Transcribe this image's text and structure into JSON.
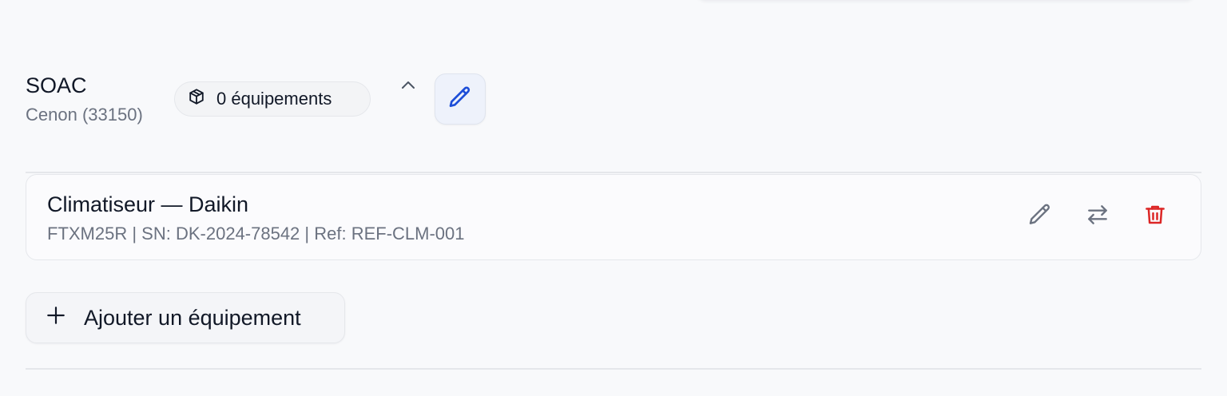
{
  "site": {
    "name": "SOAC",
    "city": "Cenon (33150)",
    "equipment_count_label": "0 équipements"
  },
  "equipment": [
    {
      "title": "Climatiseur — Daikin",
      "meta": "FTXM25R | SN: DK-2024-78542 | Ref: REF-CLM-001"
    }
  ],
  "actions": {
    "add_equipment_label": "Ajouter un équipement"
  },
  "icons": {
    "badge": "package-icon",
    "collapse": "chevron-up-icon",
    "edit_site": "pencil-icon",
    "edit_equipment": "pencil-icon",
    "transfer_equipment": "arrows-exchange-icon",
    "delete_equipment": "trash-icon",
    "add": "plus-icon"
  },
  "colors": {
    "accent": "#1d4ed8",
    "danger": "#dc2626",
    "muted": "#6b7280"
  }
}
